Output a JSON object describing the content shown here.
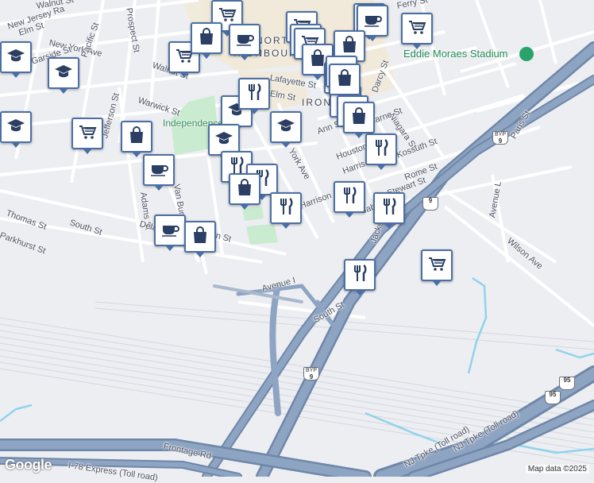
{
  "neighborhood_labels": [
    "NORTH",
    "IRONBOUND",
    "IRON"
  ],
  "parks": [
    "Independence Park"
  ],
  "landmarks": [
    "Eddie Moraes Stadium"
  ],
  "streets": [
    "Walnut St",
    "New Jersey Ra",
    "Elm St",
    "New York Ave",
    "Garside St",
    "Prospect St",
    "Ferry St",
    "Pacific St",
    "Walnut St",
    "Lafayette St",
    "Warwick St",
    "Jefferson St",
    "Elm St",
    "Darcy St",
    "Niagara St",
    "Ann St",
    "Kearne St",
    "York Ave",
    "Houston St",
    "Kossuth St",
    "Paris St",
    "Rome St",
    "Adams St",
    "Van Buren St",
    "Harrison St",
    "Harrison St",
    "Jabez St",
    "Stewart St",
    "Avenue L",
    "Thomas St",
    "South St",
    "Delancy St",
    "Malvern St",
    "Parkhurst St",
    "Wilson Ave",
    "Avenue I",
    "Jackson St",
    "South St",
    "Frontage Rd",
    "I-78 Express (Toll road)",
    "NJ Tpke (Toll road)",
    "NJ Tpke (Toll road)"
  ],
  "shields": [
    {
      "top": "BYP",
      "num": "9"
    },
    {
      "top": "",
      "num": "9"
    },
    {
      "top": "BYP",
      "num": "9"
    },
    {
      "top": "",
      "num": "95"
    },
    {
      "top": "",
      "num": "95"
    }
  ],
  "pins": [
    {
      "type": "grocery-icon"
    },
    {
      "type": "cafe-icon"
    },
    {
      "type": "school-icon"
    },
    {
      "type": "grocery-icon"
    },
    {
      "type": "cafe-icon"
    },
    {
      "type": "grocery-icon"
    },
    {
      "type": "grocery-icon"
    },
    {
      "type": "grocery-icon"
    },
    {
      "type": "shopping-icon"
    },
    {
      "type": "cafe-icon"
    },
    {
      "type": "grocery-icon"
    },
    {
      "type": "shopping-icon"
    },
    {
      "type": "shopping-icon"
    },
    {
      "type": "school-icon"
    },
    {
      "type": "school-icon"
    },
    {
      "type": "grocery-icon"
    },
    {
      "type": "grocery-icon"
    },
    {
      "type": "restaurant-icon"
    },
    {
      "type": "school-icon"
    },
    {
      "type": "shopping-icon"
    },
    {
      "type": "grocery-icon"
    },
    {
      "type": "grocery-icon"
    },
    {
      "type": "school-icon"
    },
    {
      "type": "shopping-icon"
    },
    {
      "type": "grocery-icon"
    },
    {
      "type": "shopping-icon"
    },
    {
      "type": "school-icon"
    },
    {
      "type": "restaurant-icon"
    },
    {
      "type": "restaurant-icon"
    },
    {
      "type": "cafe-icon"
    },
    {
      "type": "restaurant-icon"
    },
    {
      "type": "shopping-icon"
    },
    {
      "type": "restaurant-icon"
    },
    {
      "type": "restaurant-icon"
    },
    {
      "type": "restaurant-icon"
    },
    {
      "type": "cafe-icon"
    },
    {
      "type": "shopping-icon"
    },
    {
      "type": "restaurant-icon"
    },
    {
      "type": "grocery-icon"
    }
  ],
  "attribution": {
    "logo": "Google",
    "text": "Map data ©2025"
  },
  "colors": {
    "pin_border": "#4a6fa5",
    "highway": "#7f97b8",
    "park": "#c9ebcf",
    "water": "#8fd3ec"
  }
}
